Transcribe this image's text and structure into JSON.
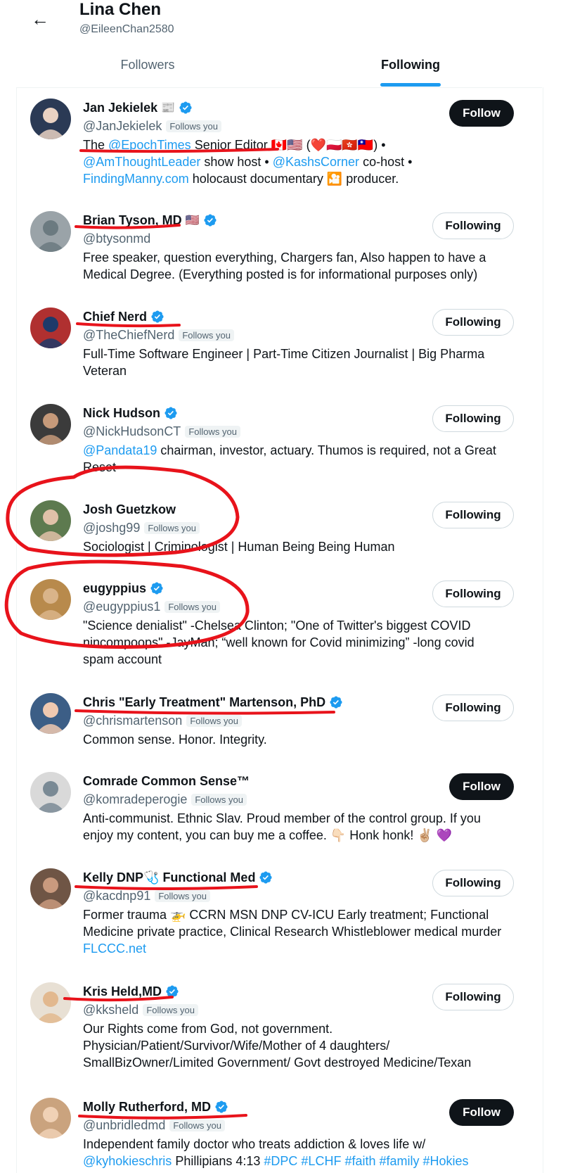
{
  "header": {
    "back_icon": "arrow-left-icon",
    "title": "Lina Chen",
    "handle": "@EileenChan2580",
    "tabs": [
      {
        "label": "Followers",
        "active": false
      },
      {
        "label": "Following",
        "active": true
      }
    ],
    "accent": "#1d9bf0"
  },
  "annotation_color": "#e8131b",
  "users": [
    {
      "name": "Jan Jekielek",
      "verified": true,
      "extra": "📰",
      "handle": "@JanJekielek",
      "follows_you": "Follows you",
      "bio_parts": [
        [
          "The ",
          ""
        ],
        [
          "@EpochTimes",
          "link"
        ],
        [
          " Senior Editor 🇨🇦🇺🇸 (❤️🇵🇱🇭🇰🇹🇼) • ",
          ""
        ],
        [
          "@AmThoughtLeader",
          "link"
        ],
        [
          " show host • ",
          ""
        ],
        [
          "@KashsCorner",
          "link"
        ],
        [
          " co-host • ",
          ""
        ],
        [
          "FindingManny.com",
          "link"
        ],
        [
          " holocaust documentary 🎦 producer.",
          ""
        ]
      ],
      "button": "Follow"
    },
    {
      "name": "Brian Tyson, MD",
      "verified": true,
      "extra": "🇺🇸",
      "handle": "@btysonmd",
      "follows_you": "",
      "bio_parts": [
        [
          "Free speaker, question everything, Chargers fan, Also happen to have a Medical Degree. (Everything posted is for informational purposes only)",
          ""
        ]
      ],
      "button": "Following"
    },
    {
      "name": "Chief Nerd",
      "verified": true,
      "extra": "",
      "handle": "@TheChiefNerd",
      "follows_you": "Follows you",
      "bio_parts": [
        [
          "Full-Time Software Engineer | Part-Time Citizen Journalist | Big Pharma Veteran",
          ""
        ]
      ],
      "button": "Following"
    },
    {
      "name": "Nick Hudson",
      "verified": true,
      "extra": "",
      "handle": "@NickHudsonCT",
      "follows_you": "Follows you",
      "bio_parts": [
        [
          "@Pandata19",
          "link"
        ],
        [
          " chairman, investor, actuary. Thumos is required, not a Great Reset",
          ""
        ]
      ],
      "button": "Following"
    },
    {
      "name": "Josh Guetzkow",
      "verified": false,
      "extra": "",
      "handle": "@joshg99",
      "follows_you": "Follows you",
      "bio_parts": [
        [
          "Sociologist | Criminologist | Human Being Being Human",
          ""
        ]
      ],
      "button": "Following"
    },
    {
      "name": "eugyppius",
      "verified": true,
      "extra": "",
      "handle": "@eugyppius1",
      "follows_you": "Follows you",
      "bio_parts": [
        [
          "\"Science denialist\" -Chelsea Clinton; \"One of Twitter's biggest COVID nincompoops\" -JayMan; “well known for Covid minimizing” -long covid spam account",
          ""
        ]
      ],
      "button": "Following"
    },
    {
      "name": "Chris \"Early Treatment\" Martenson, PhD",
      "verified": true,
      "extra": "",
      "handle": "@chrismartenson",
      "follows_you": "Follows you",
      "bio_parts": [
        [
          "Common sense. Honor. Integrity.",
          ""
        ]
      ],
      "button": "Following"
    },
    {
      "name": "Comrade Common Sense™",
      "verified": false,
      "extra": "",
      "handle": "@komradeperogie",
      "follows_you": "Follows you",
      "bio_parts": [
        [
          "Anti-communist. Ethnic Slav. Proud member of the control group. If you enjoy my content, you can buy me a coffee. 👇🏻 Honk honk! ✌🏼 💜",
          ""
        ]
      ],
      "button": "Follow"
    },
    {
      "name": "Kelly DNP🩺 Functional Med",
      "verified": true,
      "extra": "",
      "handle": "@kacdnp91",
      "follows_you": "Follows you",
      "bio_parts": [
        [
          "Former trauma 🚁 CCRN MSN DNP CV-ICU Early treatment; Functional Medicine private practice, Clinical Research Whistleblower medical murder ",
          ""
        ],
        [
          "FLCCC.net",
          "link"
        ]
      ],
      "button": "Following"
    },
    {
      "name": "Kris Held,MD",
      "verified": true,
      "extra": "",
      "handle": "@kksheld",
      "follows_you": "Follows you",
      "bio_parts": [
        [
          "Our Rights come from God, not government. Physician/Patient/Survivor/Wife/Mother of 4 daughters/ SmallBizOwner/Limited Government/ Govt destroyed Medicine/Texan",
          ""
        ]
      ],
      "button": "Following"
    },
    {
      "name": "Molly Rutherford, MD",
      "verified": true,
      "extra": "",
      "handle": "@unbridledmd",
      "follows_you": "Follows you",
      "bio_parts": [
        [
          "Independent family doctor who treats addiction & loves life w/ ",
          ""
        ],
        [
          "@kyhokieschris",
          "link"
        ],
        [
          " Phillipians 4:13 ",
          ""
        ],
        [
          "#DPC #LCHF #faith #family #Hokies",
          "link"
        ]
      ],
      "button": "Follow"
    }
  ]
}
